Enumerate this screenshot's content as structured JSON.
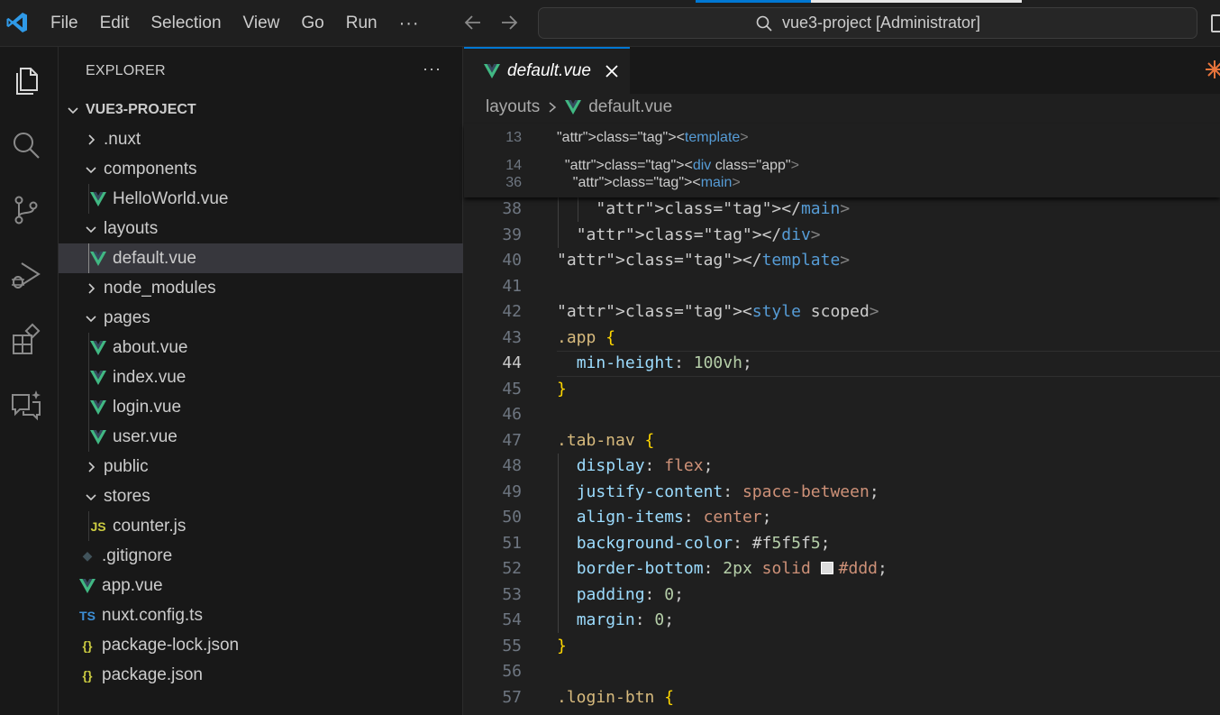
{
  "titlebar": {
    "menu": [
      "File",
      "Edit",
      "Selection",
      "View",
      "Go",
      "Run",
      "···"
    ],
    "search_text": "vue3-project [Administrator]"
  },
  "activity": [
    "explorer-icon",
    "search-icon",
    "source-control-icon",
    "run-debug-icon",
    "extensions-icon",
    "chat-icon"
  ],
  "sidebar": {
    "title": "EXPLORER",
    "more": "···",
    "root": "VUE3-PROJECT",
    "items": [
      {
        "label": ".nuxt",
        "kind": "folder",
        "expanded": false
      },
      {
        "label": "components",
        "kind": "folder",
        "expanded": true
      },
      {
        "label": "HelloWorld.vue",
        "kind": "vue"
      },
      {
        "label": "layouts",
        "kind": "folder",
        "expanded": true
      },
      {
        "label": "default.vue",
        "kind": "vue",
        "selected": true
      },
      {
        "label": "node_modules",
        "kind": "folder",
        "expanded": false
      },
      {
        "label": "pages",
        "kind": "folder",
        "expanded": true
      },
      {
        "label": "about.vue",
        "kind": "vue"
      },
      {
        "label": "index.vue",
        "kind": "vue"
      },
      {
        "label": "login.vue",
        "kind": "vue"
      },
      {
        "label": "user.vue",
        "kind": "vue"
      },
      {
        "label": "public",
        "kind": "folder",
        "expanded": false
      },
      {
        "label": "stores",
        "kind": "folder",
        "expanded": true
      },
      {
        "label": "counter.js",
        "kind": "js",
        "icon_text": "JS"
      },
      {
        "label": ".gitignore",
        "kind": "git"
      },
      {
        "label": "app.vue",
        "kind": "vue"
      },
      {
        "label": "nuxt.config.ts",
        "kind": "ts",
        "icon_text": "TS"
      },
      {
        "label": "package-lock.json",
        "kind": "json",
        "icon_text": "{}"
      },
      {
        "label": "package.json",
        "kind": "json",
        "icon_text": "{}"
      }
    ]
  },
  "editor": {
    "tab_label": "default.vue",
    "breadcrumb": {
      "folder": "layouts",
      "file": "default.vue"
    },
    "sticky_lines": [
      {
        "n": "13",
        "text": "<template>"
      },
      {
        "n": "14",
        "text": "  <div class=\"app\">"
      },
      {
        "n": "36",
        "text": "    <main>"
      }
    ],
    "lines": [
      {
        "n": "38",
        "text": "    </main>"
      },
      {
        "n": "39",
        "text": "  </div>"
      },
      {
        "n": "40",
        "text": "</template>"
      },
      {
        "n": "41",
        "text": ""
      },
      {
        "n": "42",
        "text": "<style scoped>"
      },
      {
        "n": "43",
        "text": ".app {"
      },
      {
        "n": "44",
        "text": "  min-height: 100vh;"
      },
      {
        "n": "45",
        "text": "}"
      },
      {
        "n": "46",
        "text": ""
      },
      {
        "n": "47",
        "text": ".tab-nav {"
      },
      {
        "n": "48",
        "text": "  display: flex;"
      },
      {
        "n": "49",
        "text": "  justify-content: space-between;"
      },
      {
        "n": "50",
        "text": "  align-items: center;"
      },
      {
        "n": "51",
        "text": "  background-color: #f5f5f5;"
      },
      {
        "n": "52",
        "text": "  border-bottom: 2px solid #ddd;"
      },
      {
        "n": "53",
        "text": "  padding: 0;"
      },
      {
        "n": "54",
        "text": "  margin: 0;"
      },
      {
        "n": "55",
        "text": "}"
      },
      {
        "n": "56",
        "text": ""
      },
      {
        "n": "57",
        "text": ".login-btn {"
      }
    ],
    "active_line": "44"
  },
  "colors": {
    "accent": "#0078d4",
    "vue_green": "#41b883",
    "swatch_1": "#f5f5f5",
    "swatch_2": "#dddddd"
  }
}
